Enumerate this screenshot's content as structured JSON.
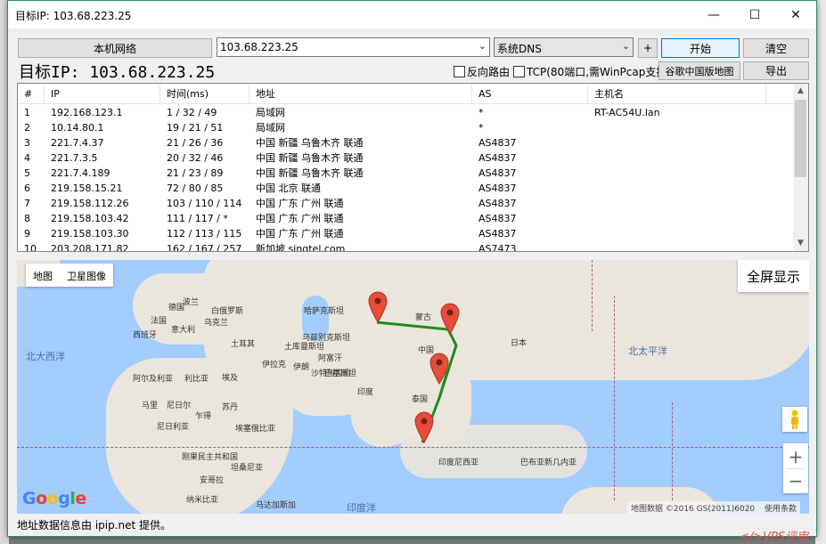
{
  "window": {
    "title": "目标IP: 103.68.223.25",
    "controls": [
      "—",
      "☐",
      "✕"
    ]
  },
  "toolbar": {
    "local_network_button": "本机网络",
    "target_input": "103.68.223.25",
    "dns_select": "系统DNS",
    "add_button": "+",
    "start_button": "开始",
    "clear_button": "清空",
    "big_target": "目标IP: 103.68.223.25",
    "reverse_route_label": "反向路由",
    "tcp_label": "TCP(80端口,需WinPcap支持)",
    "google_china_map_button": "谷歌中国版地图",
    "export_button": "导出"
  },
  "table": {
    "columns": [
      "#",
      "IP",
      "时间(ms)",
      "地址",
      "AS",
      "主机名"
    ],
    "rows": [
      [
        "1",
        "192.168.123.1",
        "1 / 32 / 49",
        "局域网",
        "*",
        "RT-AC54U.lan"
      ],
      [
        "2",
        "10.14.80.1",
        "19 / 21 / 51",
        "局域网",
        "*",
        ""
      ],
      [
        "3",
        "221.7.4.37",
        "21 / 26 / 36",
        "中国 新疆 乌鲁木齐 联通",
        "AS4837",
        ""
      ],
      [
        "4",
        "221.7.3.5",
        "20 / 32 / 46",
        "中国 新疆 乌鲁木齐 联通",
        "AS4837",
        ""
      ],
      [
        "5",
        "221.7.4.189",
        "21 / 23 / 89",
        "中国 新疆 乌鲁木齐 联通",
        "AS4837",
        ""
      ],
      [
        "6",
        "219.158.15.21",
        "72 / 80 / 85",
        "中国 北京 联通",
        "AS4837",
        ""
      ],
      [
        "7",
        "219.158.112.26",
        "103 / 110 / 114",
        "中国 广东 广州 联通",
        "AS4837",
        ""
      ],
      [
        "8",
        "219.158.103.42",
        "111 / 117 / *",
        "中国 广东 广州 联通",
        "AS4837",
        ""
      ],
      [
        "9",
        "219.158.103.30",
        "112 / 113 / 115",
        "中国 广东 广州 联通",
        "AS4837",
        ""
      ],
      [
        "10",
        "203.208.171.82",
        "162 / 167 / 257",
        "新加坡 singtel.com",
        "AS7473",
        ""
      ]
    ]
  },
  "map": {
    "type_map": "地图",
    "type_satellite": "卫星图像",
    "fullscreen": "全屏显示",
    "zoom_in": "+",
    "zoom_out": "−",
    "logo": "Google",
    "attribution": "地图数据 ©2016 GS(2011)6020",
    "terms": "使用条款",
    "route_color": "#1e8c1e",
    "labels": {
      "north_atlantic": "北大西洋",
      "north_pacific": "北太平洋",
      "indian_ocean": "印度洋",
      "kazakhstan": "哈萨克斯坦",
      "mongolia": "蒙古",
      "china": "中国",
      "japan": "日本",
      "india": "印度",
      "thailand": "泰国",
      "indonesia": "印度尼西亚",
      "png": "巴布亚新几内亚",
      "saudi": "沙特阿拉伯",
      "iran": "伊朗",
      "afghanistan": "阿富汗",
      "pakistan": "巴基斯坦",
      "iraq": "伊拉克",
      "turkey": "土耳其",
      "egypt": "埃及",
      "libya": "利比亚",
      "algeria": "阿尔及利亚",
      "mali": "马里",
      "niger": "尼日尔",
      "chad": "乍得",
      "sudan": "苏丹",
      "ethiopia": "埃塞俄比亚",
      "nigeria": "尼日利亚",
      "drc": "刚果民主共和国",
      "tanzania": "坦桑尼亚",
      "angola": "安哥拉",
      "namibia": "纳米比亚",
      "madagascar": "马达加斯加",
      "ukraine": "乌克兰",
      "poland": "波兰",
      "germany": "德国",
      "france": "法国",
      "spain": "西班牙",
      "italy": "意大利",
      "belarus": "白俄罗斯",
      "uzbekistan": "乌兹别克斯坦",
      "turkmenistan": "土库曼斯坦"
    }
  },
  "footer": {
    "text": "地址数据信息由 ipip.net 提供。"
  },
  "watermark": "</>VPS评审"
}
